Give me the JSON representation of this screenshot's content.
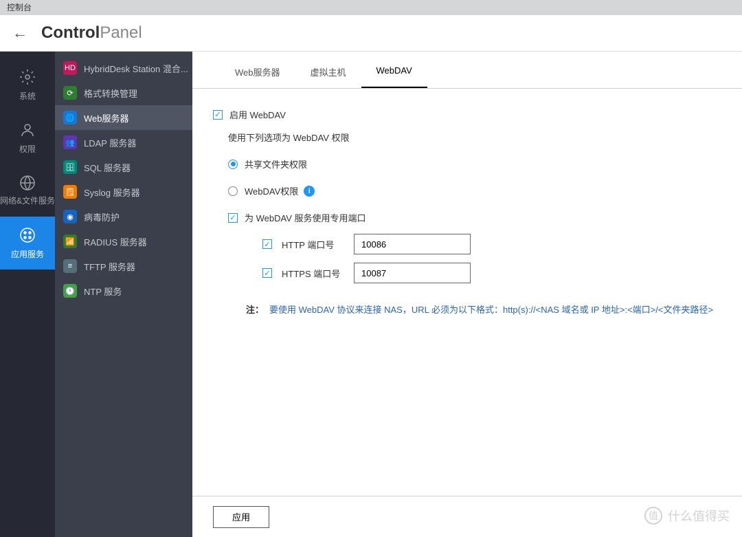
{
  "titlebar": {
    "label": "控制台"
  },
  "header": {
    "title_bold": "Control",
    "title_light": "Panel"
  },
  "nav_rail": {
    "items": [
      {
        "label": "系统"
      },
      {
        "label": "权限"
      },
      {
        "label": "网络&文件服务"
      },
      {
        "label": "应用服务"
      }
    ]
  },
  "sidebar": {
    "items": [
      {
        "label": "HybridDesk Station 混合...",
        "icon_bg": "#c2185b",
        "icon_text": "HD"
      },
      {
        "label": "格式转换管理",
        "icon_bg": "#2e7d32",
        "icon_text": "⟳"
      },
      {
        "label": "Web服务器",
        "icon_bg": "#1976d2",
        "icon_text": "🌐"
      },
      {
        "label": "LDAP 服务器",
        "icon_bg": "#5e35b1",
        "icon_text": "👥"
      },
      {
        "label": "SQL 服务器",
        "icon_bg": "#00897b",
        "icon_text": "🗄"
      },
      {
        "label": "Syslog 服务器",
        "icon_bg": "#f57c00",
        "icon_text": "🗒"
      },
      {
        "label": "病毒防护",
        "icon_bg": "#1565c0",
        "icon_text": "◉"
      },
      {
        "label": "RADIUS 服务器",
        "icon_bg": "#2e7d32",
        "icon_text": "📶"
      },
      {
        "label": "TFTP 服务器",
        "icon_bg": "#546e7a",
        "icon_text": "≡"
      },
      {
        "label": "NTP 服务",
        "icon_bg": "#43a047",
        "icon_text": "🕐"
      }
    ],
    "active_index": 2
  },
  "tabs": {
    "items": [
      {
        "label": "Web服务器"
      },
      {
        "label": "虚拟主机"
      },
      {
        "label": "WebDAV"
      }
    ],
    "active_index": 2
  },
  "form": {
    "enable_webdav": "启用 WebDAV",
    "permission_text": "使用下列选项为 WebDAV 权限",
    "radio_share": "共享文件夹权限",
    "radio_webdav": "WebDAV权限",
    "dedicated_port": "为 WebDAV 服务使用专用端口",
    "http_label": "HTTP 端口号",
    "http_value": "10086",
    "https_label": "HTTPS 端口号",
    "https_value": "10087",
    "note_label": "注：",
    "note_text": "要使用 WebDAV 协议来连接 NAS，URL 必须为以下格式：http(s)://<NAS 域名或 IP 地址>:<端口>/<文件夹路径>"
  },
  "footer": {
    "apply": "应用"
  },
  "watermark": {
    "badge": "值",
    "text": "什么值得买"
  }
}
